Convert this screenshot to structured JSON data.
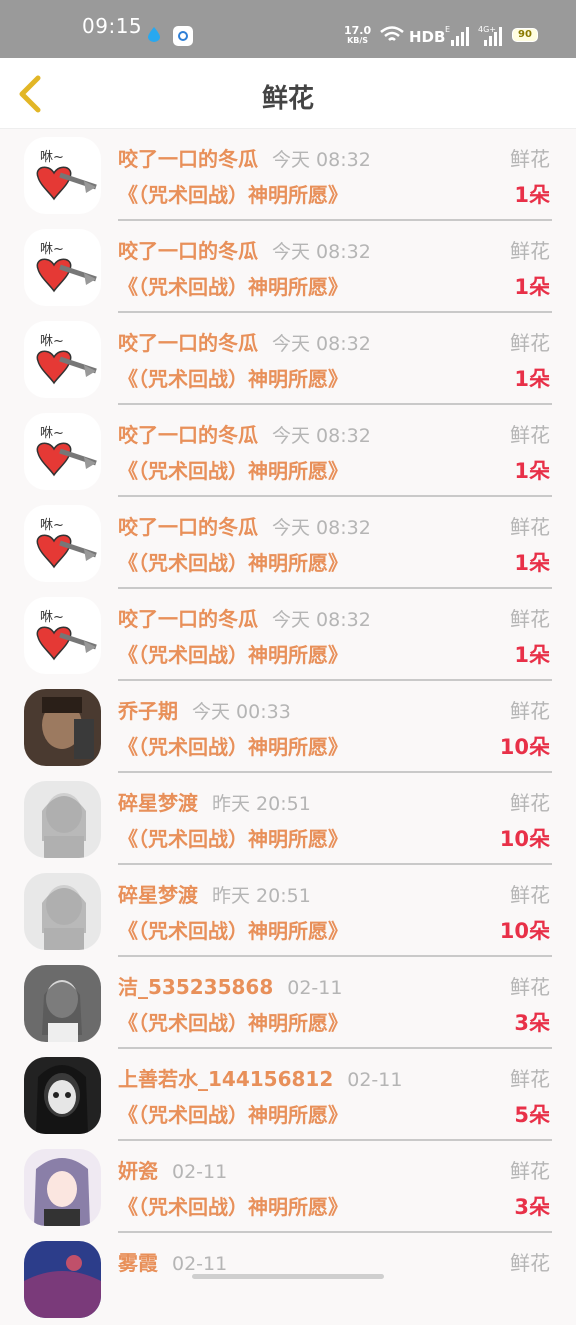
{
  "status_bar": {
    "time": "09:15",
    "speed_value": "17.0",
    "speed_unit": "KB/S",
    "hd_label": "HDB",
    "battery": "90"
  },
  "header": {
    "title": "鲜花",
    "back_icon": "chevron-left-icon"
  },
  "colors": {
    "accent": "#e8905a",
    "count": "#e83048",
    "muted": "#b5b5b5",
    "back_icon": "#e2b626"
  },
  "items": [
    {
      "user": "咬了一口的冬瓜",
      "time": "今天 08:32",
      "type": "鲜花",
      "book": "《（咒术回战）神明所愿》",
      "count": "1朵",
      "avatar": "heart"
    },
    {
      "user": "咬了一口的冬瓜",
      "time": "今天 08:32",
      "type": "鲜花",
      "book": "《（咒术回战）神明所愿》",
      "count": "1朵",
      "avatar": "heart"
    },
    {
      "user": "咬了一口的冬瓜",
      "time": "今天 08:32",
      "type": "鲜花",
      "book": "《（咒术回战）神明所愿》",
      "count": "1朵",
      "avatar": "heart"
    },
    {
      "user": "咬了一口的冬瓜",
      "time": "今天 08:32",
      "type": "鲜花",
      "book": "《（咒术回战）神明所愿》",
      "count": "1朵",
      "avatar": "heart"
    },
    {
      "user": "咬了一口的冬瓜",
      "time": "今天 08:32",
      "type": "鲜花",
      "book": "《（咒术回战）神明所愿》",
      "count": "1朵",
      "avatar": "heart"
    },
    {
      "user": "咬了一口的冬瓜",
      "time": "今天 08:32",
      "type": "鲜花",
      "book": "《（咒术回战）神明所愿》",
      "count": "1朵",
      "avatar": "heart"
    },
    {
      "user": "乔子期",
      "time": "今天 00:33",
      "type": "鲜花",
      "book": "《（咒术回战）神明所愿》",
      "count": "10朵",
      "avatar": "dark-portrait"
    },
    {
      "user": "碎星梦渡",
      "time": "昨天 20:51",
      "type": "鲜花",
      "book": "《（咒术回战）神明所愿》",
      "count": "10朵",
      "avatar": "sketch-girl"
    },
    {
      "user": "碎星梦渡",
      "time": "昨天 20:51",
      "type": "鲜花",
      "book": "《（咒术回战）神明所愿》",
      "count": "10朵",
      "avatar": "sketch-girl"
    },
    {
      "user": "洁_535235868",
      "time": "02-11",
      "type": "鲜花",
      "book": "《（咒术回战）神明所愿》",
      "count": "3朵",
      "avatar": "gray-girl"
    },
    {
      "user": "上善若水_144156812",
      "time": "02-11",
      "type": "鲜花",
      "book": "《（咒术回战）神明所愿》",
      "count": "5朵",
      "avatar": "dark-face"
    },
    {
      "user": "妍瓷",
      "time": "02-11",
      "type": "鲜花",
      "book": "《（咒术回战）神明所愿》",
      "count": "3朵",
      "avatar": "anime-girl"
    },
    {
      "user": "雾霞",
      "time": "02-11",
      "type": "鲜花",
      "book": "",
      "count": "",
      "avatar": "blue-purple"
    }
  ]
}
